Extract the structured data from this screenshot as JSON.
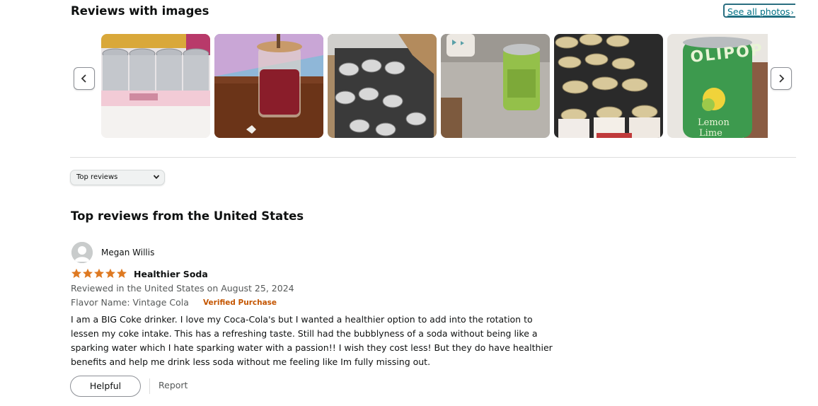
{
  "images_section": {
    "title": "Reviews with images",
    "see_all_label": "See all photos",
    "chevron_right_glyph": "›",
    "thumbnails": [
      {
        "name": "review-image-1",
        "icon": "pink-box-of-cans"
      },
      {
        "name": "review-image-2",
        "icon": "glass-jar-drink"
      },
      {
        "name": "review-image-3",
        "icon": "box-of-cans"
      },
      {
        "name": "review-image-4",
        "icon": "green-can"
      },
      {
        "name": "review-image-5",
        "icon": "cans-in-fridge"
      },
      {
        "name": "review-image-6",
        "icon": "lemon-lime-can"
      }
    ],
    "can_label_top": "OLIPOP",
    "can_label_bottom_1": "Lemon",
    "can_label_bottom_2": "Lime"
  },
  "sort": {
    "selected": "Top reviews"
  },
  "reviews": {
    "heading": "Top reviews from the United States",
    "items": [
      {
        "reviewer": "Megan Willis",
        "rating": 5,
        "title": "Healthier Soda",
        "date_line": "Reviewed in the United States on August 25, 2024",
        "flavor_line": "Flavor Name: Vintage Cola",
        "verified_label": "Verified Purchase",
        "body": "I am a BIG Coke drinker. I love my Coca-Cola's but I wanted a healthier option to add into the rotation to lessen my coke intake. This has a refreshing taste. Still had the bubblyness of a soda without being like a sparking water which I hate sparking water with a passion!! I wish they cost less! But they do have healthier benefits and help me drink less soda without me feeling like Im fully missing out.",
        "helpful_label": "Helpful",
        "report_label": "Report"
      }
    ]
  },
  "colors": {
    "star": "#de7921",
    "link": "#007185",
    "verified": "#c45500",
    "secondary_text": "#565959"
  }
}
